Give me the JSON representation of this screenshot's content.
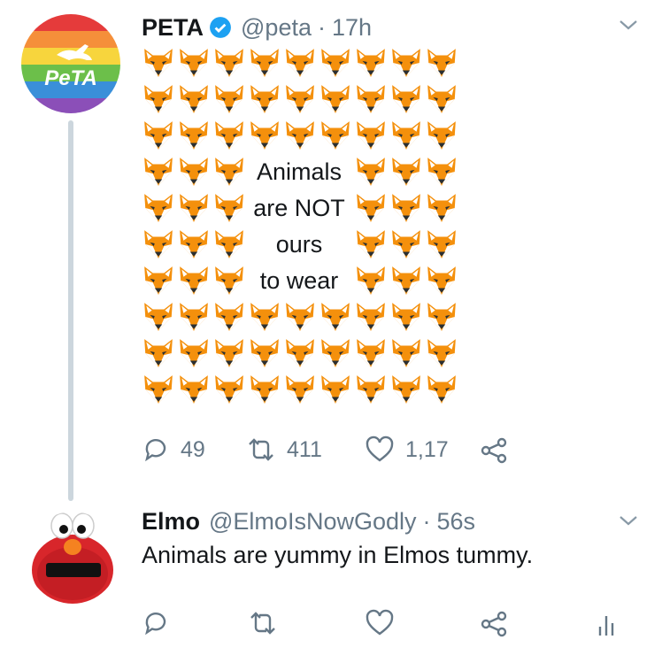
{
  "tweet": {
    "name": "PETA",
    "handle": "@peta",
    "time": "17h",
    "separator": "·",
    "avatar_text": "PeTA",
    "message_lines": [
      "Animals",
      "are NOT",
      "ours",
      "to wear"
    ],
    "fox_emoji": "fox-face",
    "stats": {
      "replies": "49",
      "retweets": "411",
      "likes": "1,17"
    }
  },
  "reply": {
    "name": "Elmo",
    "handle": "@ElmoIsNowGodly",
    "time": "56s",
    "separator": "·",
    "text": "Animals are yummy in Elmos tummy."
  },
  "colors": {
    "verified": "#1da1f2",
    "muted": "#657786",
    "thread": "#ccd6dd",
    "fox_orange": "#f4900c"
  }
}
